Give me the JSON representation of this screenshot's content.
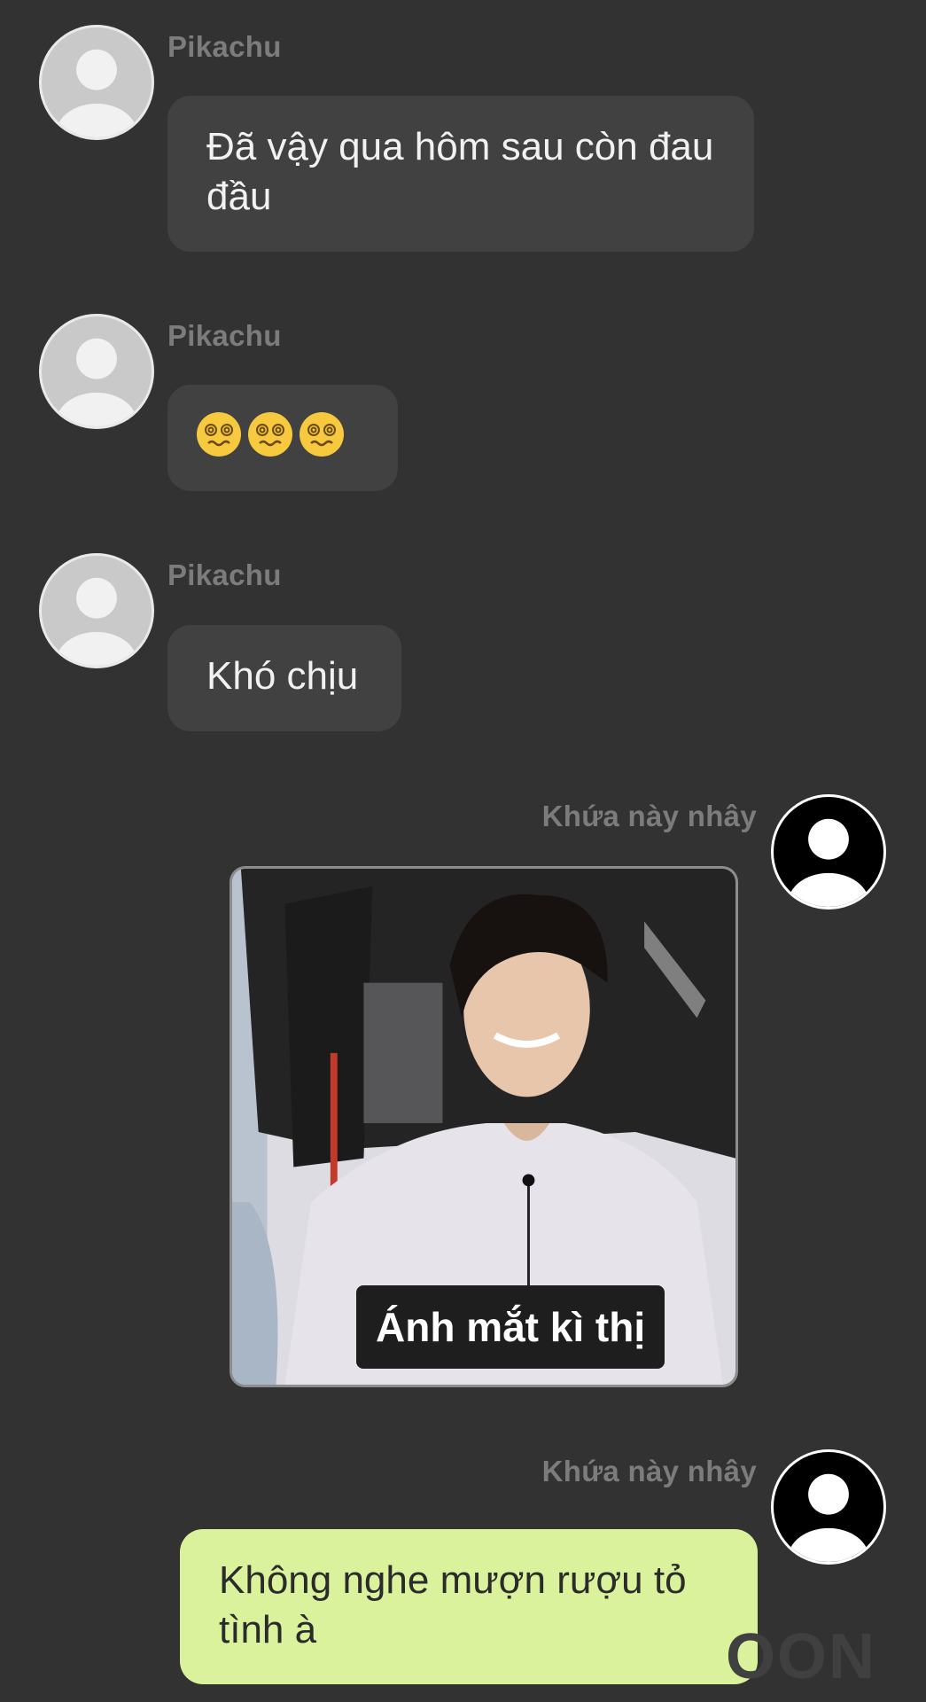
{
  "messages": [
    {
      "sender": "Pikachu",
      "text": "Đã vậy qua hôm sau còn đau đầu"
    },
    {
      "sender": "Pikachu",
      "emoji_count": 3,
      "emoji_icon": "dizzy-face-emoji"
    },
    {
      "sender": "Pikachu",
      "text": "Khó chịu"
    },
    {
      "sender": "Khứa này nhây",
      "sticker_caption": "Ánh mắt kì thị"
    },
    {
      "sender": "Khứa này nhây",
      "text": "Không nghe mượn rượu tỏ tình à"
    }
  ],
  "watermark": "OON",
  "colors": {
    "background": "#323232",
    "incoming_bubble": "#414141",
    "outgoing_bubble": "#dbf29d",
    "sender_name": "#7c7c7c"
  }
}
